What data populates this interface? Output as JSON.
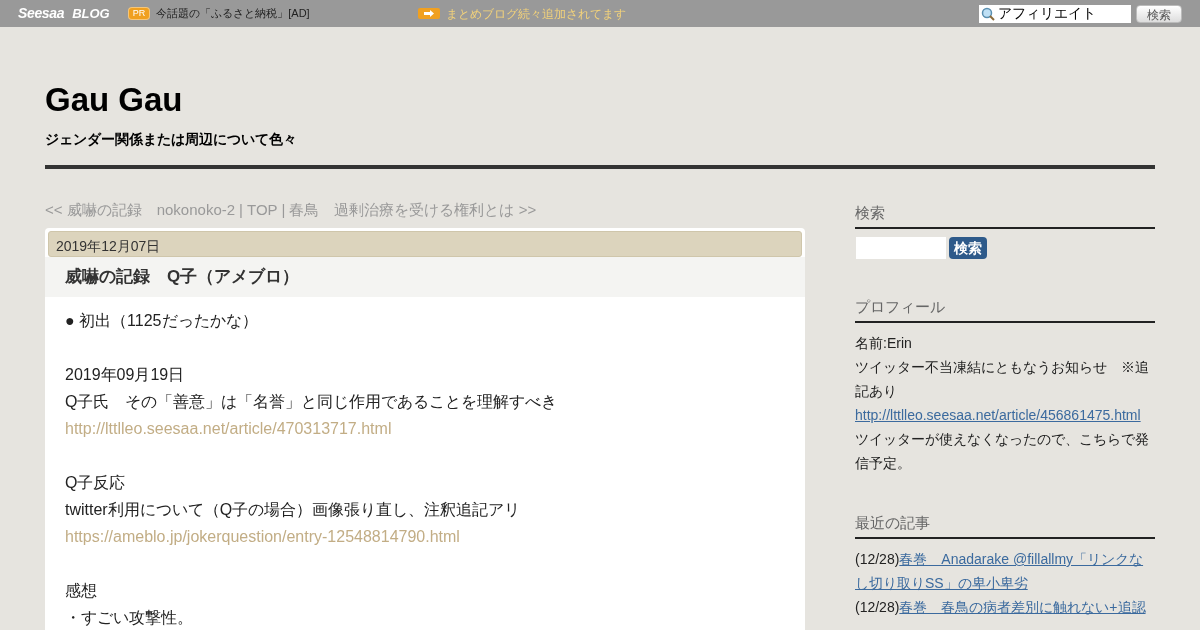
{
  "topbar": {
    "logo": "Seesaa",
    "logo_suffix": "BLOG",
    "pr_badge": "PR",
    "pr_text": "今話題の「ふるさと納税」[AD]",
    "notice": "まとめブログ続々追加されてます",
    "search": {
      "value": "アフィリエイト",
      "button": "検索"
    }
  },
  "blog": {
    "title": "Gau Gau",
    "subtitle": "ジェンダー関係または周辺について色々"
  },
  "nav": {
    "prev": "<< 威嚇の記録　nokonoko-2",
    "separator": "|",
    "top": "TOP",
    "next": "春鳥　過剰治療を受ける権利とは >>"
  },
  "article": {
    "date": "2019年12月07日",
    "title": "威嚇の記録　Q子（アメブロ）",
    "lines": [
      {
        "kind": "text",
        "text": "● 初出（1125だったかな）"
      },
      {
        "kind": "blank"
      },
      {
        "kind": "text",
        "text": "2019年09月19日"
      },
      {
        "kind": "text",
        "text": "Q子氏　その「善意」は「名誉」と同じ作用であることを理解すべき"
      },
      {
        "kind": "link",
        "text": "http://lttlleo.seesaa.net/article/470313717.html"
      },
      {
        "kind": "blank"
      },
      {
        "kind": "text",
        "text": "Q子反応"
      },
      {
        "kind": "text",
        "text": "twitter利用について（Q子の場合）画像張り直し、注釈追記アリ"
      },
      {
        "kind": "link",
        "text": "https://ameblo.jp/jokerquestion/entry-12548814790.html"
      },
      {
        "kind": "blank"
      },
      {
        "kind": "text",
        "text": "感想"
      },
      {
        "kind": "text",
        "text": "・すごい攻撃性。"
      }
    ]
  },
  "sidebar": {
    "search": {
      "heading": "検索",
      "button": "検索"
    },
    "profile": {
      "heading": "プロフィール",
      "lines": [
        {
          "kind": "text",
          "text": "名前:Erin"
        },
        {
          "kind": "text",
          "text": "ツイッター不当凍結にともなうお知らせ　※追記あり"
        },
        {
          "kind": "link",
          "text": "http://lttlleo.seesaa.net/article/456861475.html"
        },
        {
          "kind": "text",
          "text": "ツイッターが使えなくなったので、こちらで発信予定。"
        }
      ]
    },
    "recent": {
      "heading": "最近の記事",
      "items": [
        {
          "date": "(12/28)",
          "title": "春巻　Anadarake @fillallmy「リンクなし切り取りSS」の卑小卑劣"
        },
        {
          "date": "(12/28)",
          "title": "春巻　春鳥の病者差別に触れない+追認"
        }
      ]
    }
  }
}
